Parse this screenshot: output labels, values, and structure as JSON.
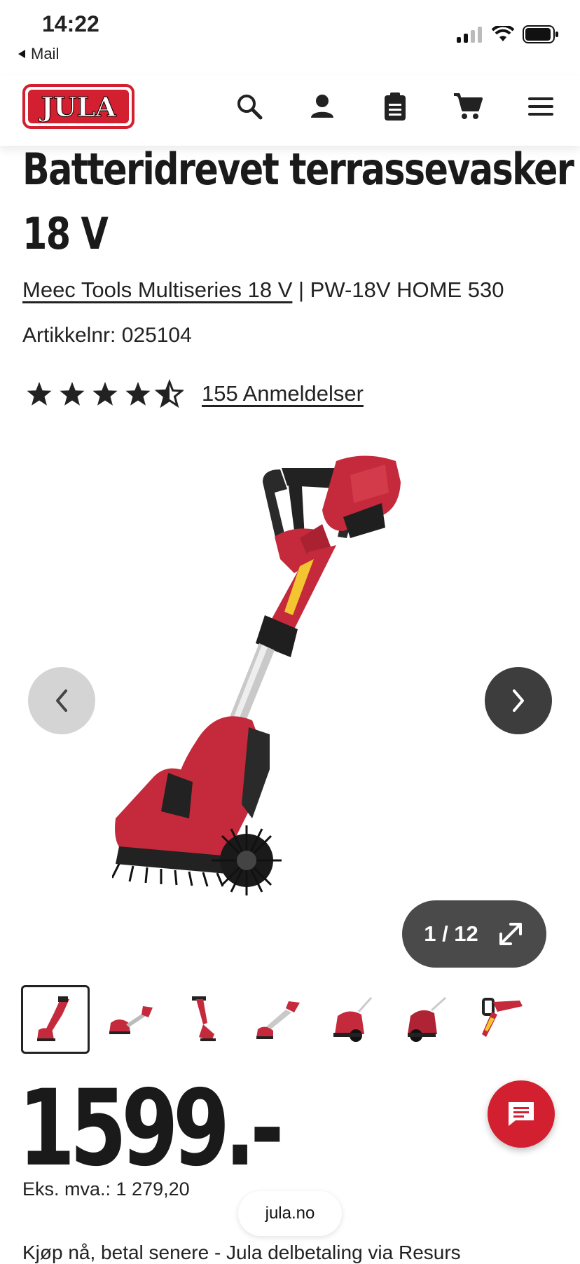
{
  "status_bar": {
    "time": "14:22",
    "back_app": "Mail"
  },
  "header": {
    "logo_text": "JULA",
    "icons": [
      "search-icon",
      "user-icon",
      "clipboard-icon",
      "cart-icon",
      "menu-icon"
    ]
  },
  "product": {
    "title_line1": "Batteridrevet terrassevasker",
    "title_line2": "18 V",
    "brand_link": "Meec Tools Multiseries 18 V",
    "separator": " | ",
    "model": "PW-18V HOME 530",
    "sku": "Artikkelnr: 025104",
    "rating": 4.5,
    "reviews": "155 Anmeldelser"
  },
  "gallery": {
    "counter": "1 / 12",
    "thumbnail_count": 7,
    "active_index": 0
  },
  "price": {
    "value": "1599.-",
    "ex_vat": "Eks. mva.: 1 279,20"
  },
  "footer": {
    "domain": "jula.no",
    "cut_text": "Kjøp nå, betal senere - Jula delbetaling via Resurs"
  },
  "colors": {
    "brand_red": "#d32030",
    "product_red": "#c42a3b",
    "text": "#222222"
  }
}
